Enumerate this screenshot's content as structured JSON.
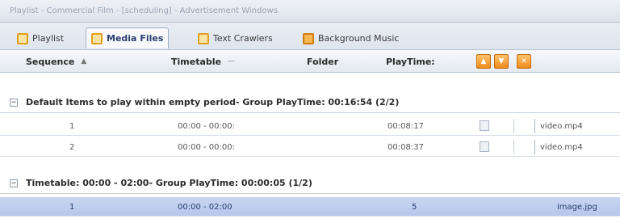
{
  "window": {
    "title": "Playlist - Commercial Film - [scheduling] - Advertisement Windows"
  },
  "tabs": [
    {
      "label": "Playlist",
      "icon": "playlist-icon"
    },
    {
      "label": "Media Files",
      "icon": "media-files-icon"
    },
    {
      "label": "Text Crawlers",
      "icon": "text-crawlers-icon"
    },
    {
      "label": "Background Music",
      "icon": "background-music-icon"
    }
  ],
  "columns": {
    "sequence": "Sequence",
    "timetable": "Timetable",
    "folder": "Folder",
    "playtime": "PlayTime:"
  },
  "groups": [
    {
      "title": "Default Items to play within empty period- Group PlayTime: 00:16:54 (2/2)",
      "rows": [
        {
          "seq": "1",
          "timetable": "00:00 - 00:00:",
          "playtime": "00:08:17",
          "file": "video.mp4"
        },
        {
          "seq": "2",
          "timetable": "00:00 - 00:00:",
          "playtime": "00:08:37",
          "file": "video.mp4"
        }
      ]
    },
    {
      "title": "Timetable: 00:00 - 02:00- Group PlayTime: 00:00:05 (1/2)",
      "rows": [
        {
          "seq": "1",
          "timetable": "00:00 - 02:00",
          "playtime": "5",
          "file": "image.jpg"
        }
      ]
    }
  ],
  "colors": {
    "accent": "#f08a1c",
    "selection": "#b6c7ec",
    "header": "#e4e9f0"
  }
}
